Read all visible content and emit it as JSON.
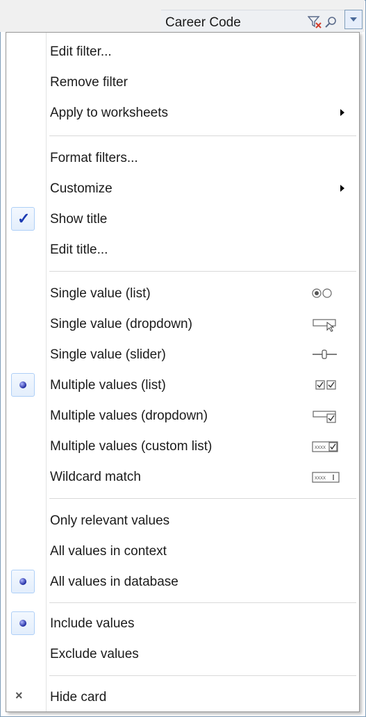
{
  "header": {
    "title": "Career Code"
  },
  "menu": {
    "group1": [
      {
        "label": "Edit filter..."
      },
      {
        "label": "Remove filter"
      },
      {
        "label": "Apply to worksheets",
        "submenu": true
      }
    ],
    "group2": [
      {
        "label": "Format filters..."
      },
      {
        "label": "Customize",
        "submenu": true
      },
      {
        "label": "Show title",
        "checked": true
      },
      {
        "label": "Edit title..."
      }
    ],
    "group3": [
      {
        "label": "Single value (list)",
        "icon": "radio-list-icon"
      },
      {
        "label": "Single value (dropdown)",
        "icon": "dropdown-select-icon"
      },
      {
        "label": "Single value (slider)",
        "icon": "slider-icon"
      },
      {
        "label": "Multiple values (list)",
        "icon": "checkbox-list-icon",
        "selected": true
      },
      {
        "label": "Multiple values (dropdown)",
        "icon": "dropdown-checkbox-icon"
      },
      {
        "label": "Multiple values (custom list)",
        "icon": "custom-list-icon",
        "icon_text": "xxxx"
      },
      {
        "label": "Wildcard match",
        "icon": "wildcard-field-icon",
        "icon_text": "xxxx"
      }
    ],
    "group4": [
      {
        "label": "Only relevant values"
      },
      {
        "label": "All values in context"
      },
      {
        "label": "All values in database",
        "selected": true
      }
    ],
    "group5": [
      {
        "label": "Include values",
        "selected": true
      },
      {
        "label": "Exclude values"
      }
    ],
    "group6": [
      {
        "label": "Hide card",
        "icon": "close-icon"
      }
    ]
  },
  "colors": {
    "selection_dot": "#1d2aa0",
    "check": "#1c3bb3",
    "frame": "#7f9db9"
  }
}
